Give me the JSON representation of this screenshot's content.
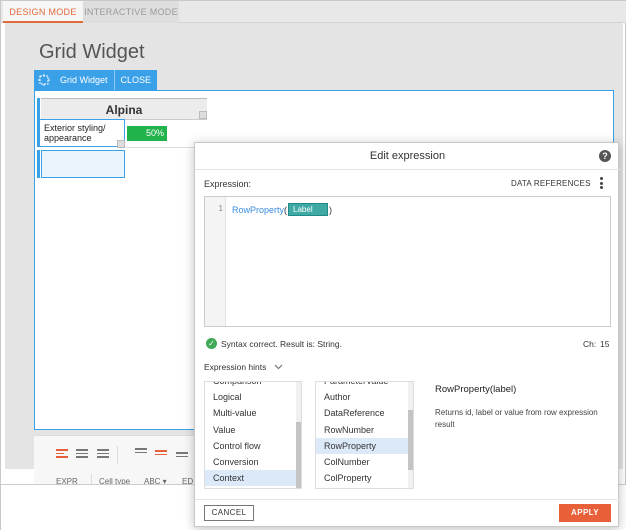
{
  "modes": {
    "design": "DESIGN MODE",
    "interactive": "INTERACTIVE MODE"
  },
  "page": {
    "title": "Grid Widget"
  },
  "widget_tabs": {
    "name": "Grid Widget",
    "close": "CLOSE"
  },
  "grid": {
    "header": "Alpina",
    "cell_label": "Exterior styling/ appearance",
    "progress_label": "50%",
    "progress_value": 0.5
  },
  "toolbar": {
    "expr": "EXPR",
    "cell_type": "Cell type",
    "abc": "ABC ▾",
    "ed": "ED"
  },
  "dialog": {
    "title": "Edit expression",
    "help": "?",
    "expression_label": "Expression:",
    "data_references": "DATA REFERENCES",
    "line_number": "1",
    "code": {
      "fn": "RowProperty",
      "open": "(",
      "chip": "Label",
      "close": ")"
    },
    "syntax_status": "Syntax correct. Result is: String.",
    "ch_label": "Ch:",
    "ch_value": "15",
    "hints_label": "Expression hints",
    "categories": [
      "Comparison",
      "Logical",
      "Multi-value",
      "Value",
      "Control flow",
      "Conversion",
      "Context"
    ],
    "functions": [
      "ParameterValue",
      "Author",
      "DataReference",
      "RowNumber",
      "RowProperty",
      "ColNumber",
      "ColProperty"
    ],
    "selected_category": "Context",
    "selected_function": "RowProperty",
    "hint_title": "RowProperty(label)",
    "hint_description": "Returns id, label or value from row expression result",
    "cancel": "CANCEL",
    "apply": "APPLY"
  },
  "colors": {
    "accent": "#e8603a",
    "selection": "#3aa0e8",
    "progress": "#22b24c",
    "chip": "#3fa9a4"
  }
}
